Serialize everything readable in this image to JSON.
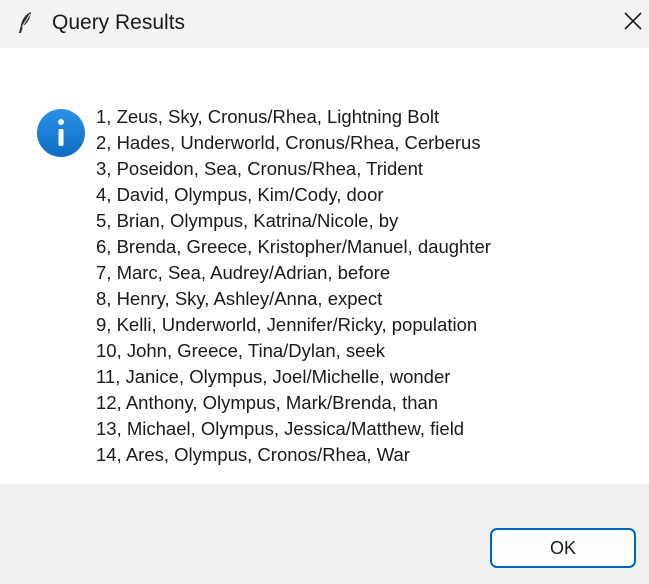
{
  "window": {
    "title": "Query Results",
    "close_label": "×"
  },
  "dialog": {
    "icon": "info-icon",
    "lines": [
      "1, Zeus, Sky, Cronus/Rhea, Lightning Bolt",
      "2, Hades, Underworld, Cronus/Rhea, Cerberus",
      "3, Poseidon, Sea, Cronus/Rhea, Trident",
      "4, David, Olympus, Kim/Cody, door",
      "5, Brian, Olympus, Katrina/Nicole, by",
      "6, Brenda, Greece, Kristopher/Manuel, daughter",
      "7, Marc, Sea, Audrey/Adrian, before",
      "8, Henry, Sky, Ashley/Anna, expect",
      "9, Kelli, Underworld, Jennifer/Ricky, population",
      "10, John, Greece, Tina/Dylan, seek",
      "11, Janice, Olympus, Joel/Michelle, wonder",
      "12, Anthony, Olympus, Mark/Brenda, than",
      "13, Michael, Olympus, Jessica/Matthew, field",
      "14, Ares, Olympus, Cronos/Rhea, War"
    ]
  },
  "footer": {
    "ok_label": "OK"
  },
  "colors": {
    "accent": "#0067c0",
    "info_icon": "#1a7fd6",
    "titlebar_bg": "#f3f3f3",
    "footer_bg": "#f0f0f0"
  }
}
